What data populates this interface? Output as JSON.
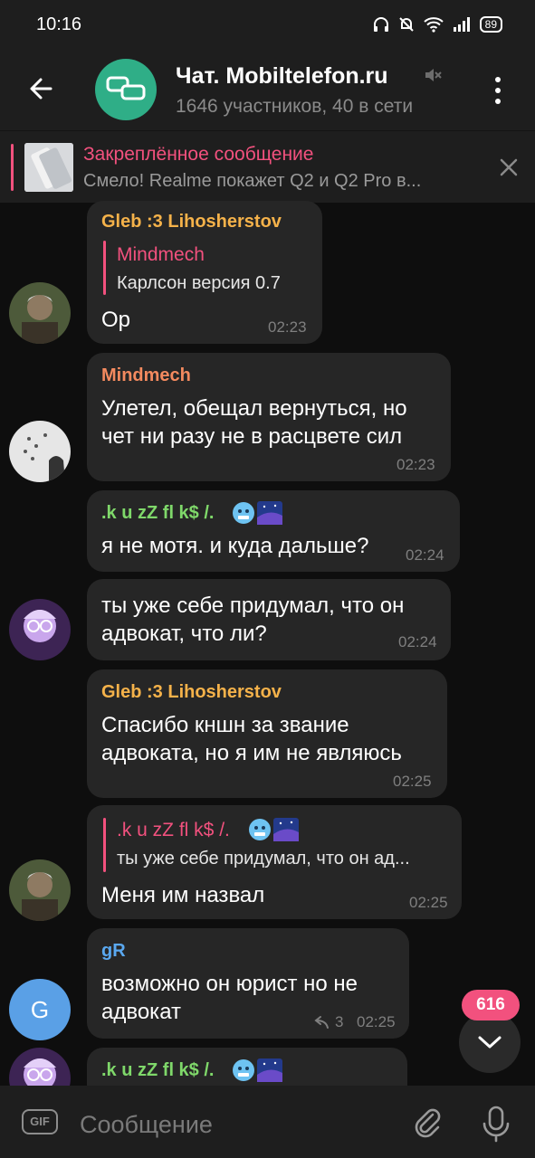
{
  "status_bar": {
    "time": "10:16",
    "battery": "89",
    "icons": [
      "headphones-icon",
      "mute-bell-icon",
      "wifi-icon",
      "signal-icon",
      "battery-icon"
    ]
  },
  "header": {
    "title": "Чат. Mobiltelefon.ru",
    "subtitle": "1646 участников, 40 в сети",
    "avatar_color": "#2fae87"
  },
  "pinned": {
    "title": "Закреплённое сообщение",
    "text": "Смело! Realme покажет Q2 и Q2 Pro в..."
  },
  "messages": [
    {
      "author": "Gleb :3 Lihosherstov",
      "author_color": "#f5b24a",
      "reply_name": "Mindmech",
      "reply_text": "Карлсон версия 0.7",
      "text": "Ор",
      "time": "02:23"
    },
    {
      "author": "Mindmech",
      "author_color": "#f48a5f",
      "text_line1": "Улетел, обещал вернуться, но",
      "text_line2": "чет ни разу не в расцвете сил",
      "time": "02:23"
    },
    {
      "author": ".k u zZ fl k$ /.",
      "author_color": "#7fd86a",
      "text": "я не мотя. и куда дальше?",
      "time": "02:24"
    },
    {
      "text_line1": "ты уже себе придумал, что он",
      "text_line2": "адвокат, что ли?",
      "time": "02:24"
    },
    {
      "author": "Gleb :3 Lihosherstov",
      "author_color": "#f5b24a",
      "text_line1": "Спасибо кншн за звание",
      "text_line2": "адвоката, но я им не являюсь",
      "time": "02:25"
    },
    {
      "reply_name": ".k u zZ fl k$ /.",
      "reply_text": "ты уже себе придумал, что он ад...",
      "text": "Меня им назвал",
      "time": "02:25"
    },
    {
      "author": "gR",
      "author_color": "#5aa8f0",
      "text_line1": "возможно он юрист но не",
      "text_line2": "адвокат",
      "replies": "3",
      "time": "02:25",
      "avatar_letter": "G"
    },
    {
      "author": ".k u zZ fl k$ /.",
      "author_color": "#7fd86a"
    }
  ],
  "unread_count": "616",
  "composer": {
    "gif_label": "GIF",
    "placeholder": "Сообщение"
  }
}
